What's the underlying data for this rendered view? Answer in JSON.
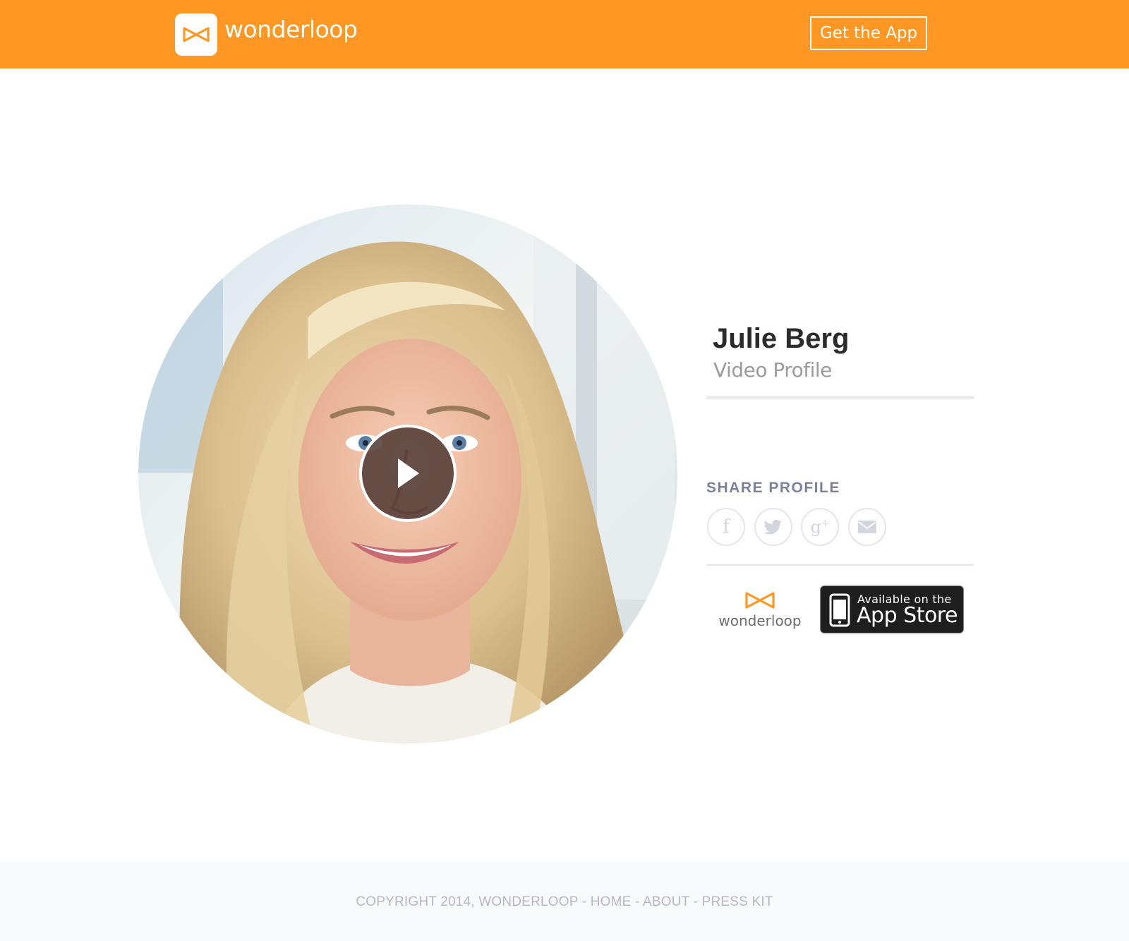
{
  "header": {
    "logo_text": "wonderloop",
    "cta_label": "Get the App"
  },
  "profile": {
    "name": "Julie Berg",
    "subtitle": "Video Profile"
  },
  "share": {
    "label": "SHARE PROFILE",
    "icons": [
      "facebook-icon",
      "twitter-icon",
      "google-plus-icon",
      "email-icon"
    ]
  },
  "badges": {
    "wonderloop_label": "wonderloop",
    "appstore_line1": "Available on the",
    "appstore_line2": "App Store"
  },
  "footer": {
    "copyright": "COPYRIGHT 2014, WONDERLOOP",
    "sep": " - ",
    "home": "HOME",
    "about": "ABOUT",
    "press": "PRESS KIT"
  },
  "colors": {
    "brand_orange": "#ff9724",
    "text_dark": "#2b2b2b",
    "text_muted": "#9b9b9b",
    "footer_text": "#b4b8c6"
  }
}
